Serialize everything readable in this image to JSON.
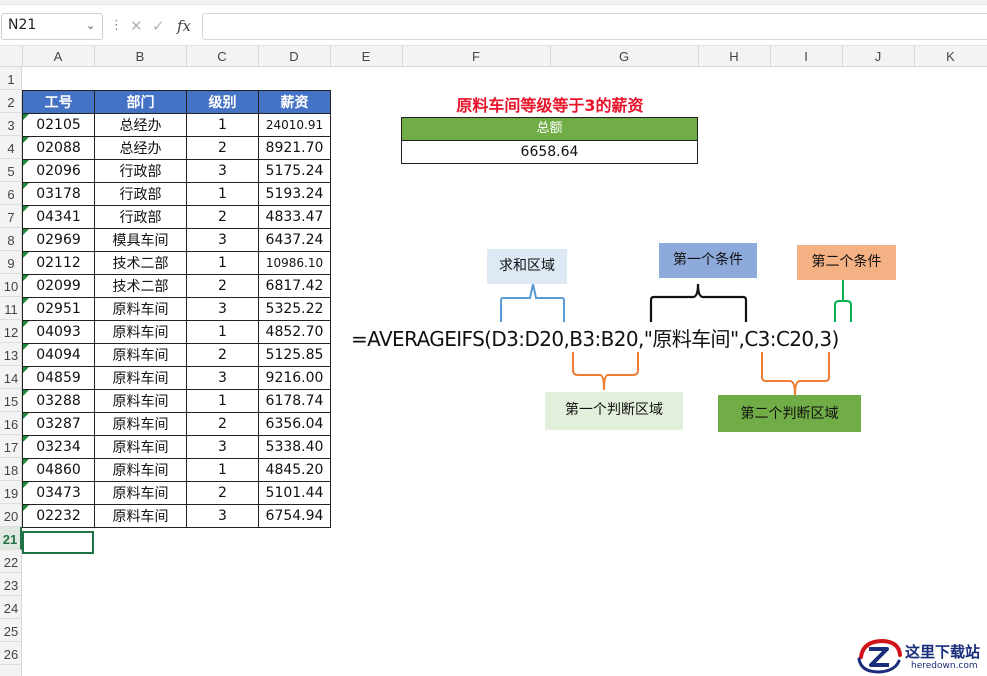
{
  "formula_bar": {
    "name_box": "N21",
    "fx": "fx",
    "cancel": "✕",
    "confirm": "✓",
    "formula": ""
  },
  "columns": [
    "A",
    "B",
    "C",
    "D",
    "E",
    "F",
    "G",
    "H",
    "I",
    "J",
    "K"
  ],
  "rows": [
    "1",
    "2",
    "3",
    "4",
    "5",
    "6",
    "7",
    "8",
    "9",
    "10",
    "11",
    "12",
    "13",
    "14",
    "15",
    "16",
    "17",
    "18",
    "19",
    "20",
    "21",
    "22",
    "23",
    "24",
    "25",
    "26"
  ],
  "selected_row": "21",
  "table": {
    "headers": [
      "工号",
      "部门",
      "级别",
      "薪资"
    ],
    "rows": [
      [
        "02105",
        "总经办",
        "1",
        "24010.91"
      ],
      [
        "02088",
        "总经办",
        "2",
        "8921.70"
      ],
      [
        "02096",
        "行政部",
        "3",
        "5175.24"
      ],
      [
        "03178",
        "行政部",
        "1",
        "5193.24"
      ],
      [
        "04341",
        "行政部",
        "2",
        "4833.47"
      ],
      [
        "02969",
        "模具车间",
        "3",
        "6437.24"
      ],
      [
        "02112",
        "技术二部",
        "1",
        "10986.10"
      ],
      [
        "02099",
        "技术二部",
        "2",
        "6817.42"
      ],
      [
        "02951",
        "原料车间",
        "3",
        "5325.22"
      ],
      [
        "04093",
        "原料车间",
        "1",
        "4852.70"
      ],
      [
        "04094",
        "原料车间",
        "2",
        "5125.85"
      ],
      [
        "04859",
        "原料车间",
        "3",
        "9216.00"
      ],
      [
        "03288",
        "原料车间",
        "1",
        "6178.74"
      ],
      [
        "03287",
        "原料车间",
        "2",
        "6356.04"
      ],
      [
        "03234",
        "原料车间",
        "3",
        "5338.40"
      ],
      [
        "04860",
        "原料车间",
        "1",
        "4845.20"
      ],
      [
        "03473",
        "原料车间",
        "2",
        "5101.44"
      ],
      [
        "02232",
        "原料车间",
        "3",
        "6754.94"
      ]
    ]
  },
  "summary": {
    "title": "原料车间等级等于3的薪资",
    "total_label": "总额",
    "total_value": "6658.64"
  },
  "annotation": {
    "formula": "=AVERAGEIFS(D3:D20,B3:B20,\"原料车间\",C3:C20,3)",
    "sum_range": "求和区域",
    "criteria1": "第一个条件",
    "criteria2": "第二个条件",
    "criteria_range1": "第一个判断区域",
    "criteria_range2": "第二个判断区域",
    "colors": {
      "sum_range": "#5b9bd5",
      "criteria1": "#000000",
      "criteria2": "#00b050",
      "criteria_range1": "#ed7d31",
      "criteria_range2": "#ed7d31"
    }
  },
  "watermark": {
    "text": "这里下载站",
    "url": "heredown.com"
  },
  "colors": {
    "header_blue": "#4472c4",
    "total_green": "#70ad47",
    "title_red": "#e8132a",
    "excel_green": "#217346"
  }
}
